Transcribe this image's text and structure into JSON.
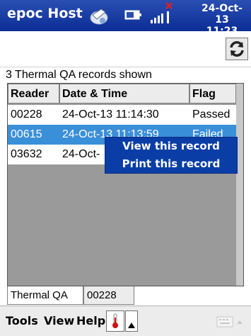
{
  "titlebar": {
    "app_title": "epoc Host",
    "clock_date": "24-Oct-13",
    "clock_time": "11:23"
  },
  "summary": "3 Thermal QA records shown",
  "table": {
    "columns": [
      "Reader",
      "Date & Time",
      "Flag"
    ],
    "rows": [
      {
        "reader": "00228",
        "datetime": "24-Oct-13 11:14:30",
        "flag": "Passed"
      },
      {
        "reader": "00615",
        "datetime": "24-Oct-13 11:13:59",
        "flag": "Failed"
      },
      {
        "reader": "03632",
        "datetime": "24-Oct-",
        "flag": ""
      }
    ]
  },
  "context_menu": {
    "view": "View this record",
    "print": "Print this record"
  },
  "tabs": [
    "Thermal QA",
    "00228"
  ],
  "menubar": {
    "tools": "Tools",
    "view": "View",
    "help": "Help"
  },
  "colors": {
    "titlebar": "#0b2d95",
    "selection": "#3a8fd9",
    "menu": "#0a3ea6"
  },
  "icons": [
    "sync-icon",
    "battery-icon",
    "signal-icon",
    "refresh-icon",
    "thermometer-icon",
    "up-arrow-icon",
    "keyboard-icon"
  ]
}
